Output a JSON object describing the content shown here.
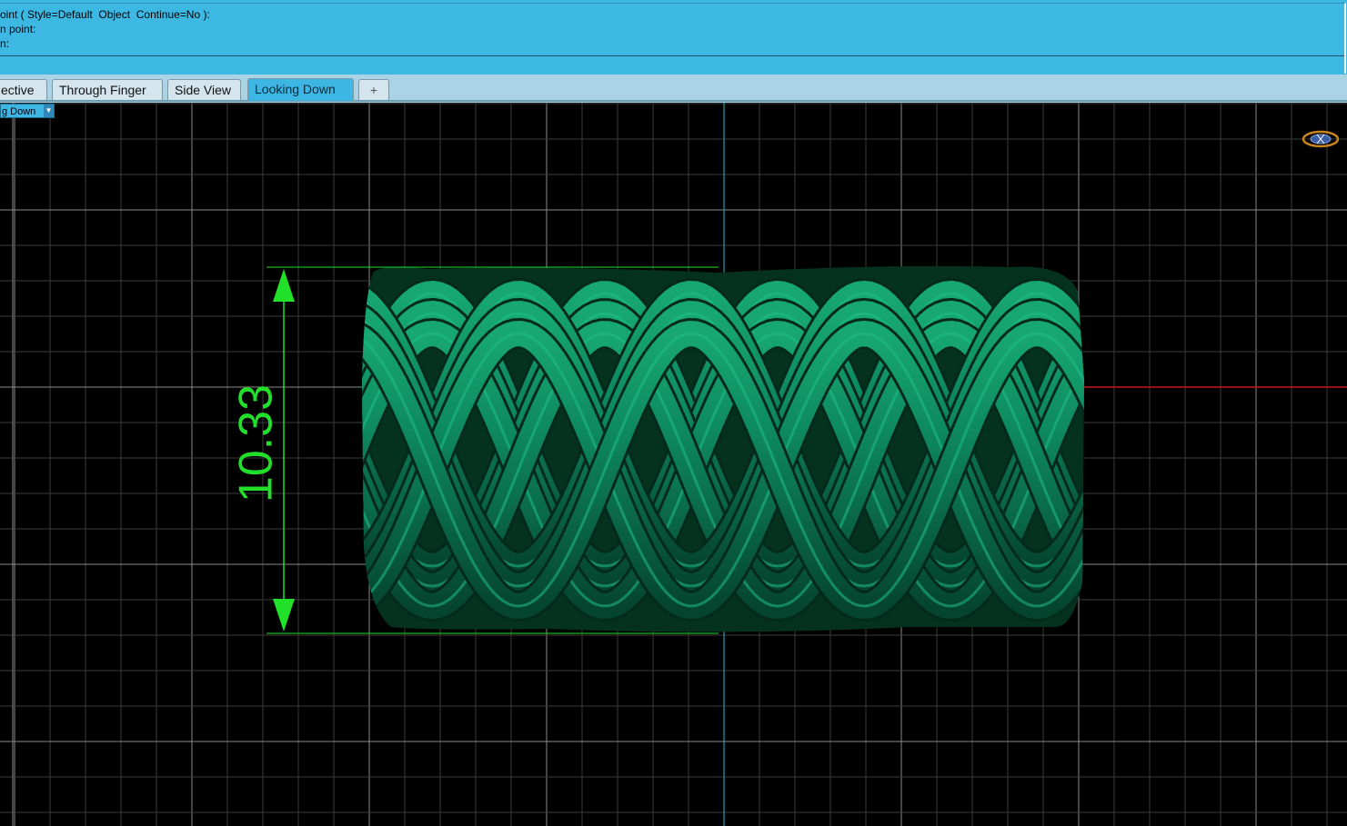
{
  "command_area": {
    "lines": [
      "oint ( Style=Default  Object  Continue=No ):",
      "n point:",
      "n:"
    ],
    "background": "#3cb8e3"
  },
  "tabs": [
    {
      "label": "ective",
      "active": false
    },
    {
      "label": "Through Finger",
      "active": false
    },
    {
      "label": "Side View",
      "active": false
    },
    {
      "label": "Looking Down",
      "active": true
    }
  ],
  "add_tab_label": "+",
  "viewport": {
    "title": "g Down",
    "dimension_value": "10.33",
    "object": "braided-ring",
    "colors": {
      "background": "#000000",
      "grid": "#3b3b3b",
      "grid_major": "#8a8a8a",
      "y_axis": "#1fa0a8",
      "x_axis": "#c81818",
      "object": "#0b7a55",
      "dimension": "#21e02a"
    }
  }
}
